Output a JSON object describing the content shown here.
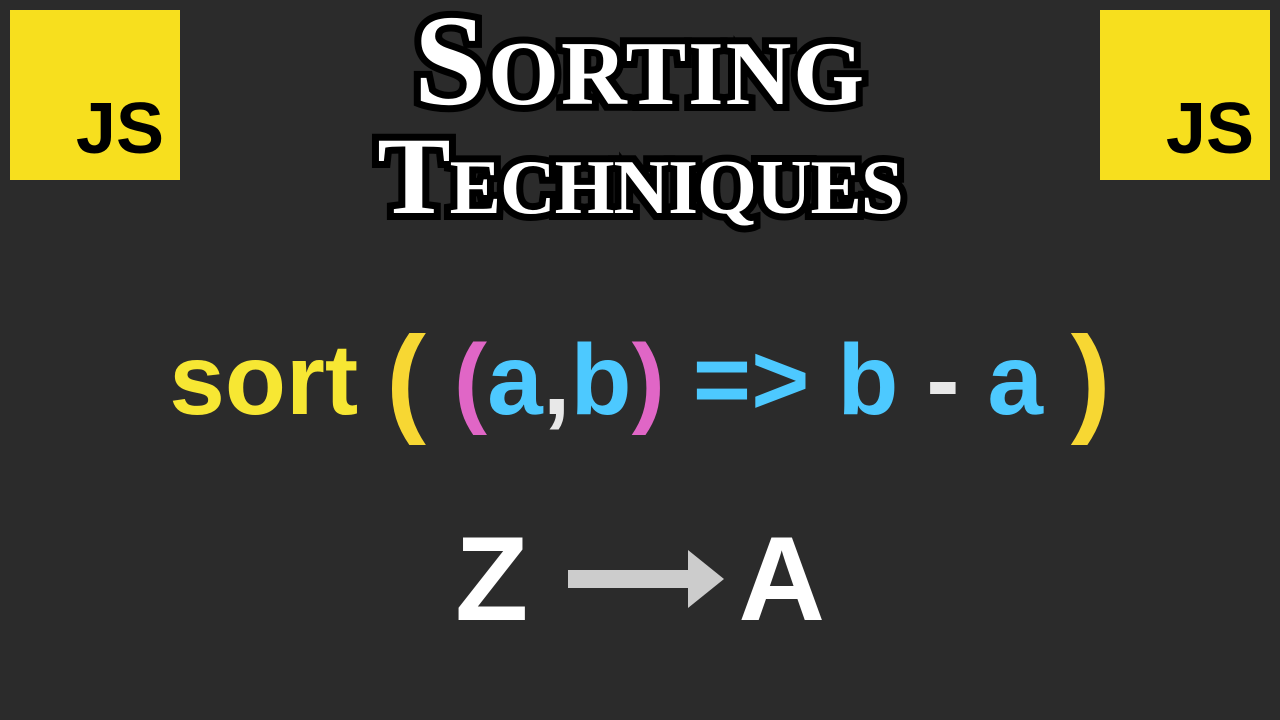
{
  "badges": {
    "left": "JS",
    "right": "JS"
  },
  "title": {
    "line1": "Sorting",
    "line2": "Techniques"
  },
  "code": {
    "method": "sort",
    "paren_outer_open": "(",
    "paren_inner_open": "(",
    "param_a": "a",
    "comma": ",",
    "param_b": "b",
    "paren_inner_close": ")",
    "arrow": "=>",
    "body_b": "b",
    "minus": "-",
    "body_a": "a",
    "paren_outer_close": ")"
  },
  "direction": {
    "from": "Z",
    "to": "A"
  }
}
